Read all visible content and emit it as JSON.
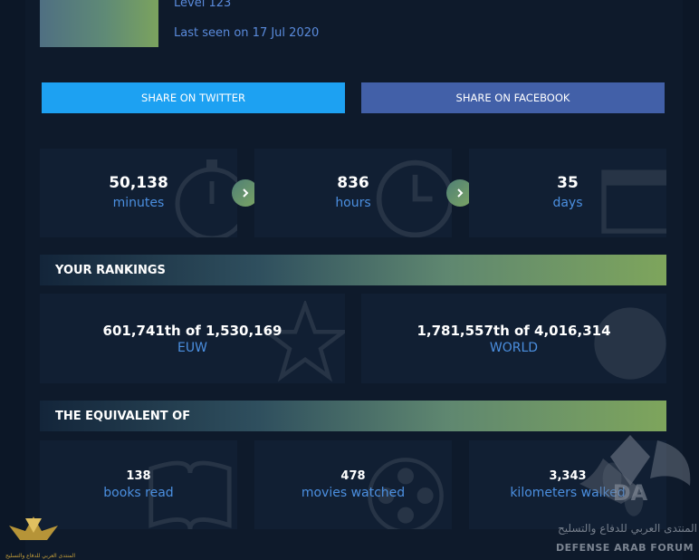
{
  "profile": {
    "level": "Level 123",
    "last_seen": "Last seen on 17 Jul 2020"
  },
  "share": {
    "twitter": "SHARE ON TWITTER",
    "facebook": "SHARE ON FACEBOOK"
  },
  "time_stats": [
    {
      "value": "50,138",
      "unit": "minutes",
      "icon": "stopwatch-icon"
    },
    {
      "value": "836",
      "unit": "hours",
      "icon": "clock-icon"
    },
    {
      "value": "35",
      "unit": "days",
      "icon": "calendar-icon"
    }
  ],
  "rankings": {
    "title": "YOUR RANKINGS",
    "items": [
      {
        "value": "601,741th of 1,530,169",
        "label": "EUW",
        "icon": "star-icon"
      },
      {
        "value": "1,781,557th of 4,016,314",
        "label": "WORLD",
        "icon": "globe-icon"
      }
    ]
  },
  "equivalent": {
    "title": "THE EQUIVALENT OF",
    "items": [
      {
        "value": "138",
        "label": "books read",
        "icon": "book-icon"
      },
      {
        "value": "478",
        "label": "movies watched",
        "icon": "film-reel-icon"
      },
      {
        "value": "3,343",
        "label": "kilometers walked",
        "icon": "footsteps-icon"
      }
    ]
  },
  "watermark": {
    "arabic": "المنتدى العربي للدفاع والتسليح",
    "english": "DEFENSE ARAB FORUM",
    "small_arabic": "المنتدى العربي للدفاع والتسليح"
  },
  "colors": {
    "background": "#0c1727",
    "card": "#111f33",
    "accent_text": "#4b8fe0",
    "twitter": "#1da1f2",
    "facebook": "#4260a8",
    "gradient_end": "#7ea55c"
  }
}
